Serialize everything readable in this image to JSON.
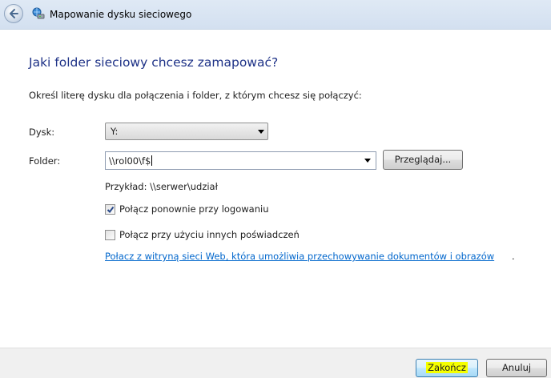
{
  "window": {
    "title": "Mapowanie dysku sieciowego",
    "back_icon": "back-arrow-icon",
    "title_icon": "network-drive-icon"
  },
  "main": {
    "heading": "Jaki folder sieciowy chcesz zamapować?",
    "instruction": "Określ literę dysku dla połączenia i folder, z którym chcesz się połączyć:",
    "drive": {
      "label": "Dysk:",
      "value": "Y:"
    },
    "folder": {
      "label": "Folder:",
      "value": "\\\\rol00\\f$",
      "browse_label": "Przeglądaj..."
    },
    "example": "Przykład: \\\\serwer\\udział",
    "reconnect": {
      "label": "Połącz ponownie przy logowaniu",
      "checked": true
    },
    "other_credentials": {
      "label": "Połącz przy użyciu innych poświadczeń",
      "checked": false
    },
    "link": "Połacz z witryną sieci Web, która umożliwia przechowywanie dokumentów i obrazów",
    "link_suffix": "."
  },
  "footer": {
    "finish_label": "Zakończ",
    "cancel_label": "Anuluj"
  },
  "colors": {
    "heading": "#1e3287",
    "link": "#0066cc",
    "highlight": "#f5ff00"
  }
}
